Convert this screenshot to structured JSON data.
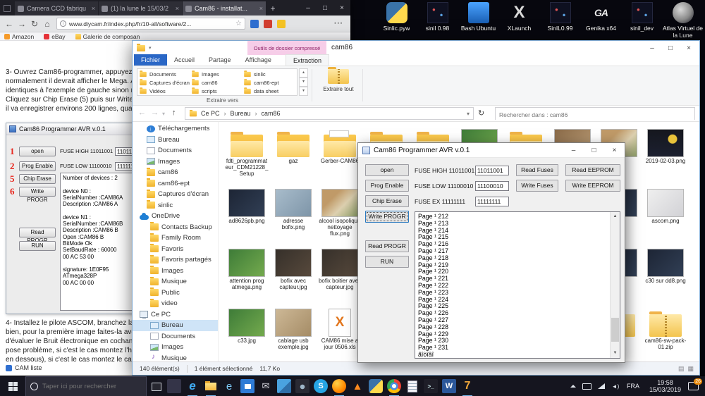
{
  "desktop": {
    "icons": [
      {
        "label": "Sinlic.pyw",
        "kind": "python"
      },
      {
        "label": "sinil 0.98",
        "kind": "dark"
      },
      {
        "label": "Bash Ubuntu",
        "kind": "ubuntu"
      },
      {
        "label": "XLaunch",
        "kind": "xlaunch"
      },
      {
        "label": "SinIL0.99",
        "kind": "dark"
      },
      {
        "label": "Genika x64",
        "kind": "genika"
      },
      {
        "label": "sinil_dev",
        "kind": "dark"
      },
      {
        "label": "Atlas Virtuel de la Lune",
        "kind": "moon"
      }
    ]
  },
  "browser": {
    "tabs": [
      {
        "label": "Camera CCD fabriqu",
        "cls": ""
      },
      {
        "label": "(1) la lune le 15/03/2",
        "cls": ""
      },
      {
        "label": "Cam86 - installat...",
        "cls": "active"
      }
    ],
    "url": "www.diycam.fr/index.php/fr/10-all/software/2...",
    "bookmarks": [
      {
        "label": "Amazon",
        "icon": "amazon"
      },
      {
        "label": "eBay",
        "icon": "ebay"
      },
      {
        "label": "Galerie de composan",
        "icon": "folder"
      }
    ],
    "para3": "3- Ouvrez Cam86-programmer, appuyez success\nnormalement il devrait afficher le Mega. Appuyez\nidentiques à l'exemple de gauche sinon modifiez\nCliquez sur Chip Erase (5) puis sur Write prog (6\nil va enregistrer environs 200 lignes, quand c'est",
    "para4": "4- Installez le pilote ASCOM, branchez la CAM e\nbien, pour la première image faites-la avec un te\nd'évaluer le Bruit électronique en cochant la case\npose problème, si c'est le cas montez l'histogram\nen dessous), si c'est le cas montez le capteur, si",
    "footer_link": "CAM liste"
  },
  "tutorial": {
    "title": "Cam86 Programmer AVR v.0.1",
    "buttons": [
      {
        "label": "open",
        "num": "1"
      },
      {
        "label": "Prog Enable",
        "num": "2"
      },
      {
        "label": "Chip Erase",
        "num": "5"
      },
      {
        "label": "Write PROGR",
        "num": "6"
      },
      {
        "label": "Read PROGR",
        "num": ""
      },
      {
        "label": "RUN",
        "num": ""
      }
    ],
    "fuses": [
      {
        "label": "FUSE HIGH 11011001",
        "value": "11011001"
      },
      {
        "label": "FUSE LOW 11100010",
        "value": "11111111"
      }
    ],
    "log": "Number of devices : 2\n\ndevice N0 :\nSerialNumber :CAM86A\nDescription :CAM86 A\n\ndevice N1 :\nSerialNumber :CAM86B\nDescription :CAM86 B\nOpen :CAM86 B\nBitMode Ok\nSetBaudRate : 60000\n00 AC 53 00\n\nsignature: 1E0F95\nATmega328P\n00 AC 00 00"
  },
  "explorer": {
    "contextual_tab_header": "Outils de dossier compressé",
    "title": "cam86",
    "ribbon_tabs": [
      {
        "label": "Fichier",
        "cls": "file"
      },
      {
        "label": "Accueil",
        "cls": ""
      },
      {
        "label": "Partage",
        "cls": ""
      },
      {
        "label": "Affichage",
        "cls": ""
      },
      {
        "label": "Extraction",
        "cls": "active"
      }
    ],
    "gallery_items": [
      {
        "label": "Documents"
      },
      {
        "label": "Captures d'écran"
      },
      {
        "label": "Vidéos"
      },
      {
        "label": "Images"
      },
      {
        "label": "cam86"
      },
      {
        "label": "scripts"
      },
      {
        "label": "sinlic"
      },
      {
        "label": "cam86-ept"
      },
      {
        "label": "data sheet"
      }
    ],
    "gallery_label": "Extraire vers",
    "extract_all": "Extraire tout",
    "breadcrumb": [
      {
        "label": "Ce PC"
      },
      {
        "label": "Bureau"
      },
      {
        "label": "cam86"
      }
    ],
    "search_placeholder": "Rechercher dans : cam86",
    "nav": [
      {
        "label": "Téléchargements",
        "icon": "downloads",
        "cls": "i1"
      },
      {
        "label": "Bureau",
        "icon": "desktop",
        "cls": "i1"
      },
      {
        "label": "Documents",
        "icon": "docs",
        "cls": "i1"
      },
      {
        "label": "Images",
        "icon": "pics",
        "cls": "i1"
      },
      {
        "label": "cam86",
        "icon": "folder",
        "cls": "i1"
      },
      {
        "label": "cam86-ept",
        "icon": "folder",
        "cls": "i1"
      },
      {
        "label": "Captures d'écran",
        "icon": "folder",
        "cls": "i1"
      },
      {
        "label": "sinlic",
        "icon": "folder",
        "cls": "i1"
      },
      {
        "label": "OneDrive",
        "icon": "cloud",
        "cls": "i0"
      },
      {
        "label": "Contacts Backup",
        "icon": "folder",
        "cls": "i2"
      },
      {
        "label": "Family Room",
        "icon": "folder",
        "cls": "i2"
      },
      {
        "label": "Favoris",
        "icon": "folder",
        "cls": "i2"
      },
      {
        "label": "Favoris partagés",
        "icon": "folder",
        "cls": "i2"
      },
      {
        "label": "Images",
        "icon": "folder",
        "cls": "i2"
      },
      {
        "label": "Musique",
        "icon": "folder",
        "cls": "i2"
      },
      {
        "label": "Public",
        "icon": "folder",
        "cls": "i2"
      },
      {
        "label": "video",
        "icon": "folder",
        "cls": "i2"
      },
      {
        "label": "Ce PC",
        "icon": "pc",
        "cls": "i0"
      },
      {
        "label": "Bureau",
        "icon": "desktop",
        "cls": "i2 sel"
      },
      {
        "label": "Documents",
        "icon": "docs",
        "cls": "i2"
      },
      {
        "label": "Images",
        "icon": "pics",
        "cls": "i2"
      },
      {
        "label": "Musique",
        "icon": "music",
        "cls": "i2"
      }
    ],
    "files": [
      {
        "label": "fdti_programmateur_CDM21228_Setup",
        "kind": "folder",
        "pos": "c0 r0"
      },
      {
        "label": "gaz",
        "kind": "folder",
        "pos": "c1 r0"
      },
      {
        "label": "Gerber-CAM86",
        "kind": "folder-full",
        "pos": "c2 r0"
      },
      {
        "label": "",
        "kind": "folder",
        "pos": "c3 r0"
      },
      {
        "label": "",
        "kind": "folder",
        "pos": "c4 r0"
      },
      {
        "label": "",
        "kind": "img-green",
        "pos": "c5 r0"
      },
      {
        "label": "",
        "kind": "folder",
        "pos": "c6 r0"
      },
      {
        "label": "",
        "kind": "img-brown",
        "pos": "c7 r0"
      },
      {
        "label": "",
        "kind": "img-photo",
        "pos": "c8 r0"
      },
      {
        "label": "2019-02-03.png",
        "kind": "img-night",
        "pos": "c9 r0"
      },
      {
        "label": "ad8626pb.png",
        "kind": "img-dark",
        "pos": "c0 r1"
      },
      {
        "label": "adresse bofix.png",
        "kind": "img-blue",
        "pos": "c1 r1"
      },
      {
        "label": "alcool isopolique nettoyage flux.png",
        "kind": "img-photo",
        "pos": "c2 r1"
      },
      {
        "label": "",
        "kind": "img-dark",
        "pos": "c8 r1"
      },
      {
        "label": "ascom.png",
        "kind": "img-light",
        "pos": "c9 r1"
      },
      {
        "label": "attention prog atmega.png",
        "kind": "img-green",
        "pos": "c0 r2"
      },
      {
        "label": "bofix avec capteur.jpg",
        "kind": "img-darkphoto",
        "pos": "c1 r2"
      },
      {
        "label": "bofix boitier avec capteur.jpg",
        "kind": "img-darkphoto",
        "pos": "c2 r2"
      },
      {
        "label": "",
        "kind": "img-dark",
        "pos": "c8 r2"
      },
      {
        "label": "c30 sur dd8.png",
        "kind": "img-dark",
        "pos": "c9 r2"
      },
      {
        "label": "c33.jpg",
        "kind": "img-green",
        "pos": "c0 r3"
      },
      {
        "label": "cablage usb exemple.jpg",
        "kind": "img-tan",
        "pos": "c1 r3"
      },
      {
        "label": "CAM86 mise a jour 0506.xls",
        "kind": "xls",
        "pos": "c2 r3"
      },
      {
        "label": "",
        "kind": "zip",
        "pos": "c8 r3"
      },
      {
        "label": "cam86-sw-pack-01.zip",
        "kind": "zip",
        "pos": "c9 r3"
      }
    ],
    "status_items": "140 élément(s)",
    "status_selected": "1 élément sélectionné",
    "status_size": "11,7 Ko"
  },
  "programmer": {
    "title": "Cam86 Programmer AVR v.0.1",
    "buttons": [
      {
        "label": "open",
        "cls": ""
      },
      {
        "label": "Prog Enable",
        "cls": ""
      },
      {
        "label": "Chip Erase",
        "cls": ""
      },
      {
        "label": "Write PROGR",
        "cls": "focused"
      },
      {
        "label": "Read PROGR",
        "cls": ""
      },
      {
        "label": "RUN",
        "cls": ""
      }
    ],
    "fuses": [
      {
        "label": "FUSE HIGH 11011001",
        "value": "11011001"
      },
      {
        "label": "FUSE LOW 11100010",
        "value": "11100010"
      },
      {
        "label": "FUSE EX 11111111",
        "value": "11111111"
      }
    ],
    "read_fuses": "Read Fuses",
    "write_fuses": "Write Fuses",
    "read_eeprom": "Read EEPROM",
    "write_eeprom": "Write EEPROM",
    "log": "Page ¹ 212\nPage ¹ 213\nPage ¹ 214\nPage ¹ 215\nPage ¹ 216\nPage ¹ 217\nPage ¹ 218\nPage ¹ 219\nPage ¹ 220\nPage ¹ 221\nPage ¹ 222\nPage ¹ 223\nPage ¹ 224\nPage ¹ 225\nPage ¹ 226\nPage ¹ 227\nPage ¹ 228\nPage ¹ 229\nPage ¹ 230\nPage ¹ 231\nãîòîâî"
  },
  "taskbar": {
    "search_placeholder": "Taper ici pour rechercher",
    "apps": [
      {
        "kind": "app-dim",
        "cls": ""
      },
      {
        "kind": "edge",
        "cls": "open"
      },
      {
        "kind": "explorer",
        "cls": "open"
      },
      {
        "kind": "ie",
        "cls": ""
      },
      {
        "kind": "store",
        "cls": ""
      },
      {
        "kind": "mail",
        "cls": ""
      },
      {
        "kind": "photos",
        "cls": ""
      },
      {
        "kind": "camera",
        "cls": ""
      },
      {
        "kind": "skype",
        "cls": ""
      },
      {
        "kind": "firefox",
        "cls": "open"
      },
      {
        "kind": "vlc",
        "cls": ""
      },
      {
        "kind": "python",
        "cls": ""
      },
      {
        "kind": "chrome",
        "cls": "open"
      },
      {
        "kind": "notepad",
        "cls": ""
      },
      {
        "kind": "terminal",
        "cls": ""
      },
      {
        "kind": "word",
        "cls": ""
      },
      {
        "kind": "sevenplus",
        "cls": "open"
      }
    ],
    "tray_lang": "FRA",
    "tray_time": "19:58",
    "tray_date": "15/03/2019",
    "badge": "26"
  }
}
